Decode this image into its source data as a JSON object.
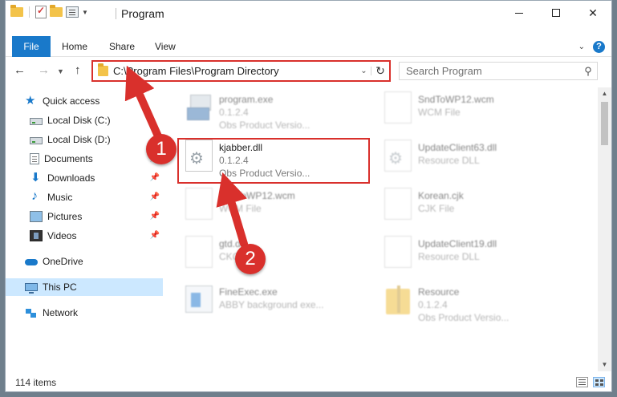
{
  "colors": {
    "accent": "#1979ca",
    "annotation": "#d9302c",
    "selection": "#cce8ff"
  },
  "window": {
    "title": "Program"
  },
  "ribbon": {
    "tabs": [
      "File",
      "Home",
      "Share",
      "View"
    ]
  },
  "address": {
    "path": "C:\\Program Files\\Program Directory"
  },
  "search": {
    "placeholder": "Search Program"
  },
  "sidebar": {
    "items": [
      {
        "label": "Quick access",
        "icon": "star-icon",
        "pinned": false
      },
      {
        "label": "Local Disk (C:)",
        "icon": "drive-icon",
        "pinned": false
      },
      {
        "label": "Local Disk (D:)",
        "icon": "drive-icon",
        "pinned": false
      },
      {
        "label": "Documents",
        "icon": "documents-icon",
        "pinned": true
      },
      {
        "label": "Downloads",
        "icon": "downloads-icon",
        "pinned": true
      },
      {
        "label": "Music",
        "icon": "music-icon",
        "pinned": true
      },
      {
        "label": "Pictures",
        "icon": "pictures-icon",
        "pinned": true
      },
      {
        "label": "Videos",
        "icon": "videos-icon",
        "pinned": true
      },
      {
        "label": "OneDrive",
        "icon": "onedrive-icon",
        "pinned": false
      },
      {
        "label": "This PC",
        "icon": "this-pc-icon",
        "pinned": false,
        "selected": true
      },
      {
        "label": "Network",
        "icon": "network-icon",
        "pinned": false
      }
    ]
  },
  "files": [
    {
      "name": "program.exe",
      "line2": "0.1.2.4",
      "line3": "Obs   Product Versio...",
      "icon": "exe-icon"
    },
    {
      "name": "SndToWP12.wcm",
      "line2": "WCM File",
      "line3": "",
      "icon": "file-icon"
    },
    {
      "name": "kjabber.dll",
      "line2": "0.1.2.4",
      "line3": "Obs   Product Versio...",
      "icon": "dll-gear-icon",
      "highlighted": true
    },
    {
      "name": "UpdateClient63.dll",
      "line2": "Resource DLL",
      "line3": "",
      "icon": "dll-gear-icon"
    },
    {
      "name": "SndToWP12.wcm",
      "line2": "WCM File",
      "line3": "",
      "icon": "file-icon"
    },
    {
      "name": "Korean.cjk",
      "line2": "CJK File",
      "line3": "",
      "icon": "file-icon"
    },
    {
      "name": "gtd.dll",
      "line2": "CKC",
      "line3": "",
      "icon": "file-icon"
    },
    {
      "name": "UpdateClient19.dll",
      "line2": "Resource DLL",
      "line3": "",
      "icon": "file-icon"
    },
    {
      "name": "FineExec.exe",
      "line2": "ABBY background exe...",
      "line3": "",
      "icon": "app-icon"
    },
    {
      "name": "Resource",
      "line2": "0.1.2.4",
      "line3": "Obs   Product Versio...",
      "icon": "folder-zip-icon"
    }
  ],
  "status": {
    "count": "114 items"
  },
  "annotations": {
    "step1": "1",
    "step2": "2"
  }
}
